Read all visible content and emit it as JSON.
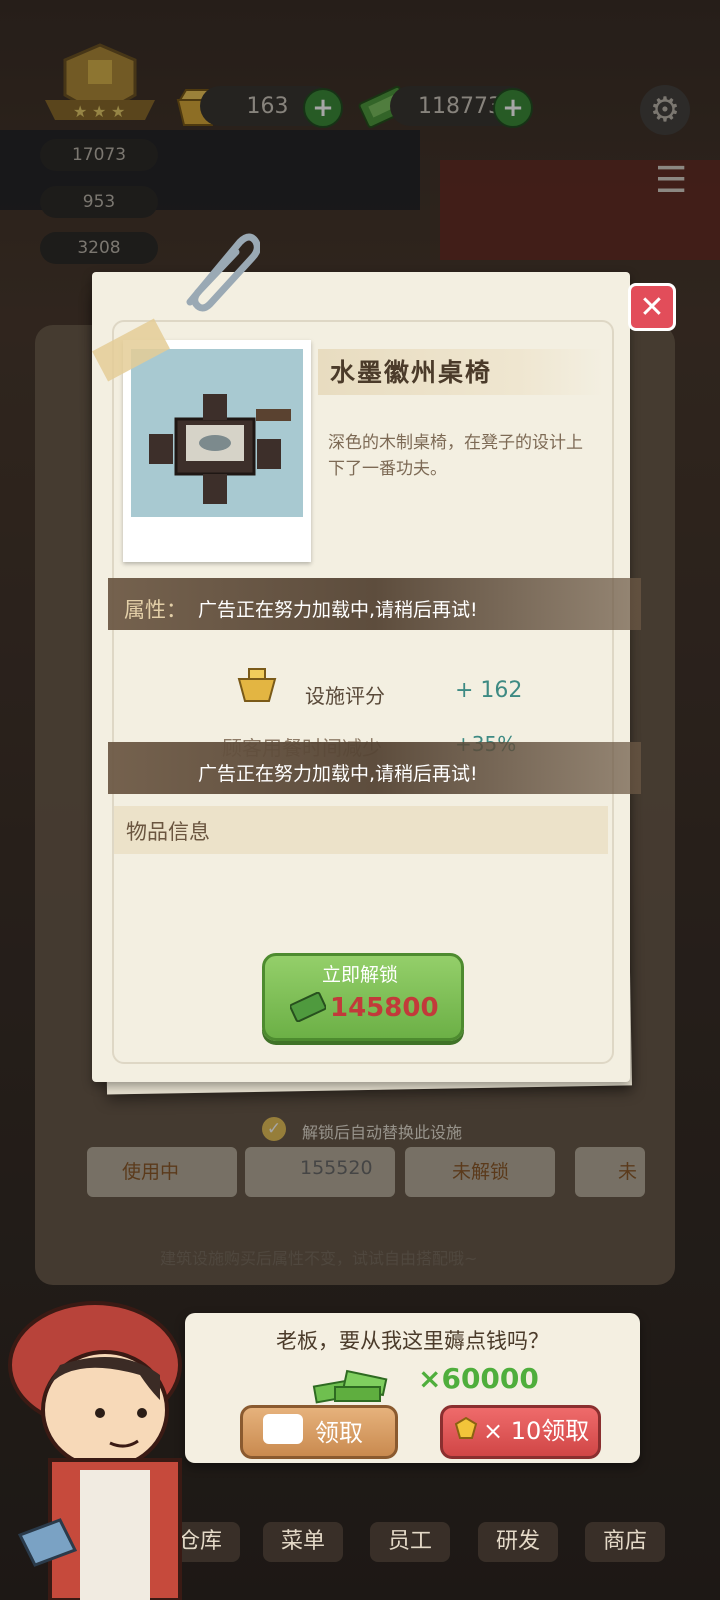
{
  "hud": {
    "gold": "163",
    "cash": "118773",
    "stats": [
      "17073",
      "953",
      "3208"
    ]
  },
  "item": {
    "name": "水墨徽州桌椅",
    "description": "深色的木制桌椅，在凳子的设计上下了一番功夫。",
    "attribute_label": "属性：",
    "ad_notice": "广告正在努力加载中,请稍后再试!",
    "rating_label": "设施评分",
    "rating_value": "+ 162",
    "dining_label": "顾客用餐时间减少",
    "dining_value": "+35%",
    "info_label": "物品信息",
    "unlock_label": "立即解锁",
    "unlock_price": "145800"
  },
  "behind": {
    "auto_replace": "解锁后自动替换此设施",
    "in_use": "使用中",
    "price2": "155520",
    "locked": "未解锁",
    "locked_short": "未",
    "hint": "建筑设施购买后属性不变，试试自由搭配哦~"
  },
  "promo": {
    "question": "老板，要从我这里薅点钱吗？",
    "amount": "×60000",
    "claim": "领取",
    "gem_claim": "× 10领取"
  },
  "tabs": [
    "仓库",
    "菜单",
    "员工",
    "研发",
    "商店"
  ],
  "colors": {
    "accent_green": "#6cb046",
    "price_red": "#c23a3a",
    "close_red": "#e24d5a"
  }
}
